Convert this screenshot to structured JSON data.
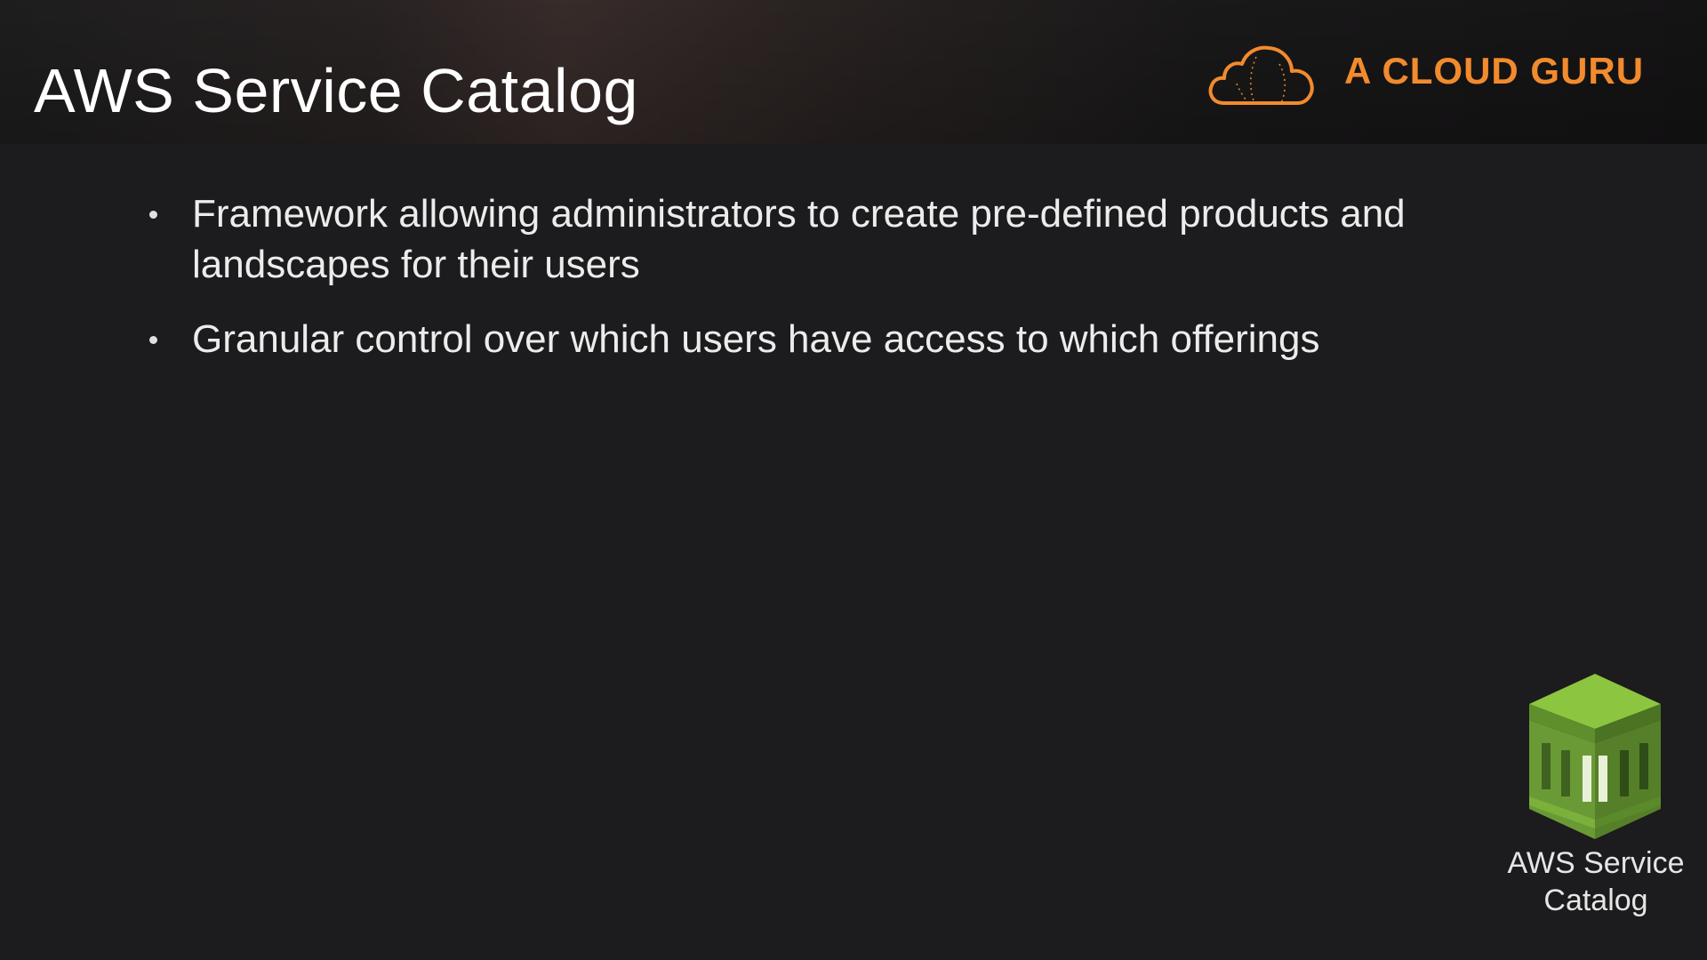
{
  "slide": {
    "title": "AWS Service Catalog",
    "brand": {
      "name": "A CLOUD GURU",
      "icon": "cloud-logo-icon",
      "color": "#f28b2d"
    },
    "bullets": [
      "Framework allowing administrators to create pre-defined products and landscapes for their users",
      "Granular control over which users have access to which offerings"
    ],
    "service_badge": {
      "icon": "aws-service-catalog-icon",
      "label": "AWS Service Catalog",
      "color": "#6a9a35"
    }
  }
}
